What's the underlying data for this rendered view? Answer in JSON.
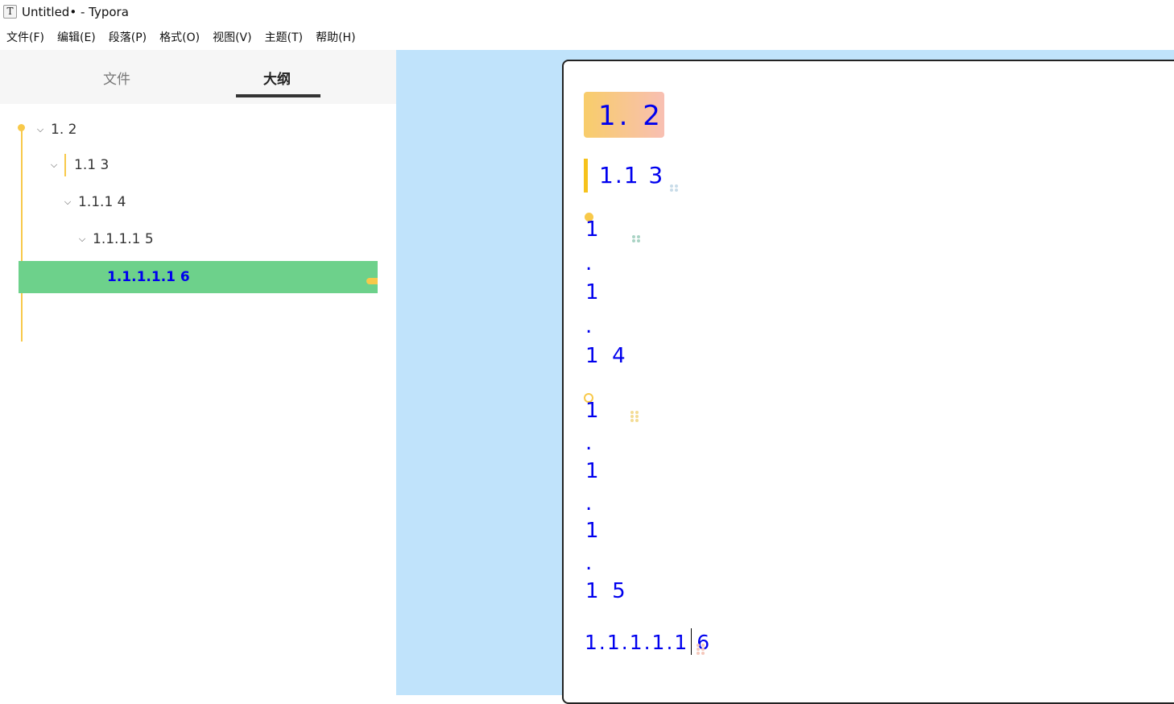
{
  "window": {
    "title": "Untitled• - Typora",
    "app_icon": "T"
  },
  "menu": [
    "文件(F)",
    "编辑(E)",
    "段落(P)",
    "格式(O)",
    "视图(V)",
    "主题(T)",
    "帮助(H)"
  ],
  "sidebar": {
    "tabs": {
      "files": "文件",
      "outline": "大纲",
      "active": "outline"
    },
    "outline": [
      {
        "label": "1. 2",
        "level": 1,
        "expanded": true
      },
      {
        "label": "1.1 3",
        "level": 2,
        "expanded": true
      },
      {
        "label": "1.1.1 4",
        "level": 3,
        "expanded": true
      },
      {
        "label": "1.1.1.1 5",
        "level": 4,
        "expanded": true
      },
      {
        "label": "1.1.1.1.1 6",
        "level": 5,
        "active": true
      }
    ]
  },
  "document": {
    "h1": "1. 2",
    "h2": "1.1 3",
    "h3_lines": [
      "1",
      ".",
      "1",
      ".",
      "1  4"
    ],
    "h4_lines": [
      "1",
      ".",
      "1",
      ".",
      "1",
      ".",
      "1  5"
    ],
    "h5": "1.1.1.1.1 6"
  },
  "colors": {
    "editor_background": "#c0e3fb",
    "heading_text": "#0000ee",
    "accent_yellow": "#f8c94a",
    "outline_active": "#6dd18b",
    "h1_gradient": [
      "#f8cd6a",
      "#f8bfb2"
    ]
  }
}
